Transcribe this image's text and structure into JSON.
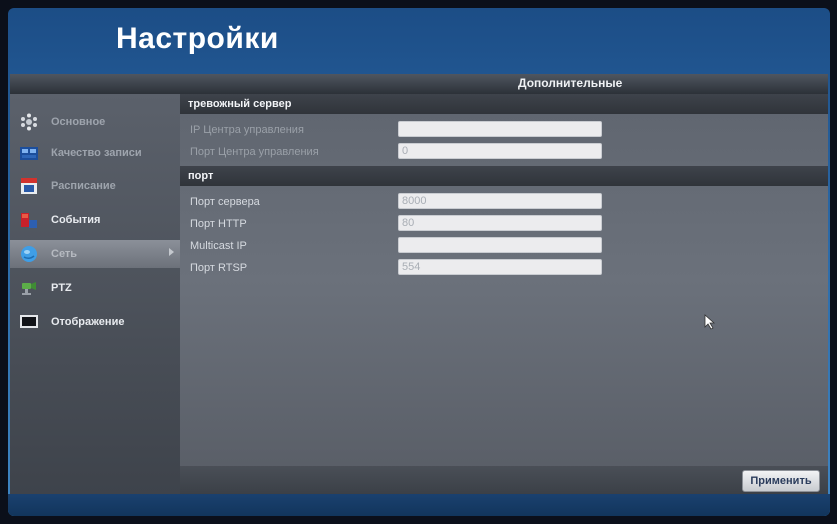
{
  "title": "Настройки",
  "tab": {
    "label": "Дополнительные"
  },
  "sidebar": {
    "items": [
      {
        "label": "Основное",
        "icon": "gear-icon"
      },
      {
        "label": "Качество записи",
        "icon": "film-icon"
      },
      {
        "label": "Расписание",
        "icon": "calendar-icon"
      },
      {
        "label": "События",
        "icon": "alarm-event-icon"
      },
      {
        "label": "Сеть",
        "icon": "network-globe-icon",
        "selected": true
      },
      {
        "label": "PTZ",
        "icon": "ptz-camera-icon"
      },
      {
        "label": "Отображение",
        "icon": "monitor-icon"
      }
    ]
  },
  "sections": {
    "alarm_server": {
      "header": "тревожный сервер",
      "fields": [
        {
          "label": "IP Центра управления",
          "value": ""
        },
        {
          "label": "Порт Центра управления",
          "value": "0"
        }
      ]
    },
    "port": {
      "header": "порт",
      "fields": [
        {
          "label": "Порт сервера",
          "value": "8000"
        },
        {
          "label": "Порт HTTP",
          "value": "80"
        },
        {
          "label": "Multicast IP",
          "value": ""
        },
        {
          "label": "Порт RTSP",
          "value": "554"
        }
      ]
    }
  },
  "footer": {
    "apply_label": "Применить"
  },
  "colors": {
    "background_blue": "#2b6aa8",
    "panel_gray": "#5f656f",
    "header_dark": "#30343a",
    "input_bg": "#ececee",
    "button_text": "#2b3c5c"
  }
}
